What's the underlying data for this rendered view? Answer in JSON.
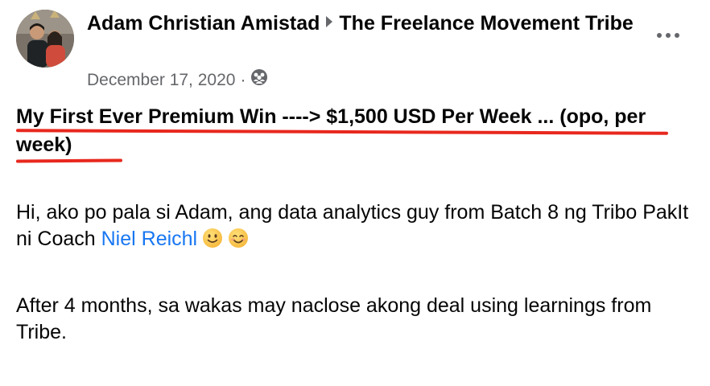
{
  "post": {
    "author": "Adam Christian Amistad",
    "group": "The Freelance Movement Tribe",
    "date": "December 17, 2020",
    "separator": "·",
    "privacy_icon": "group-members-icon",
    "title": "My First Ever Premium Win ----> $1,500 USD Per Week ... (opo, per week)",
    "paragraph1_text": "Hi, ako po pala si Adam, ang data analytics guy from Batch 8 ng Tribo PakIt ni Coach ",
    "mention": "Niel Reichl",
    "emojis": [
      "slightly-smiling-face",
      "smiling-face-with-smiling-eyes"
    ],
    "paragraph2": "After 4 months, sa wakas may naclose akong deal using learnings from Tribe."
  },
  "colors": {
    "text": "#050505",
    "secondary": "#65676b",
    "link": "#1877f2",
    "highlight_underline": "#e8281e"
  }
}
